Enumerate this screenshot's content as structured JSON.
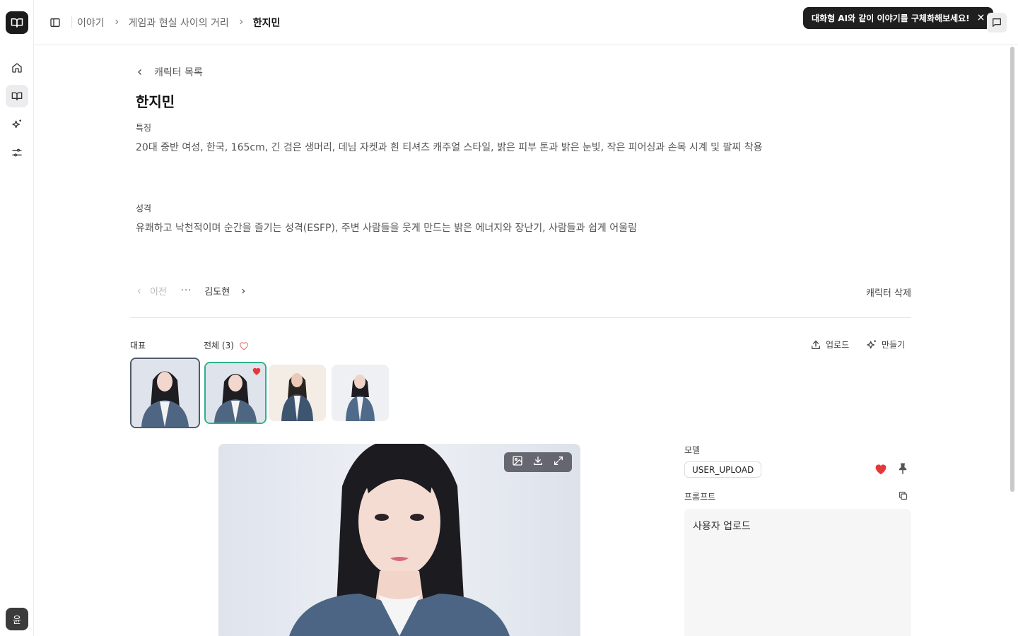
{
  "header": {
    "breadcrumb": [
      "이야기",
      "게임과 현실 사이의 거리",
      "한지민"
    ],
    "tooltip": "대화형 AI와 같이 이야기를 구체화해보세요!"
  },
  "rail": {
    "items": [
      "home-icon",
      "book-icon",
      "sparkles-icon",
      "sliders-icon"
    ],
    "avatar": "윤"
  },
  "character": {
    "back_label": "캐릭터 목록",
    "name": "한지민",
    "features_label": "특징",
    "features": "20대 중반 여성, 한국, 165cm, 긴 검은 생머리, 데님 자켓과 흰 티셔츠 캐주얼 스타일, 밝은 피부 톤과 밝은 눈빛, 작은 피어싱과 손목 시계 및 팔찌 착용",
    "personality_label": "성격",
    "personality": "유쾌하고 낙천적이며 순간을 즐기는 성격(ESFP), 주변 사람들을 웃게 만드는 밝은 에너지와 장난기, 사람들과 쉽게 어울림"
  },
  "pager": {
    "prev": "이전",
    "more": "···",
    "next": "김도현",
    "delete": "캐릭터 삭제"
  },
  "gallery": {
    "representative_label": "대표",
    "all_label": "전체 (3)",
    "upload_label": "업로드",
    "create_label": "만들기"
  },
  "detail": {
    "model_label": "모델",
    "model_value": "USER_UPLOAD",
    "prompt_label": "프롬프트",
    "prompt_value": "사용자 업로드"
  },
  "colors": {
    "accent_green": "#2bb389",
    "heart_red": "#e5383b",
    "dark": "#1b1b1b"
  }
}
